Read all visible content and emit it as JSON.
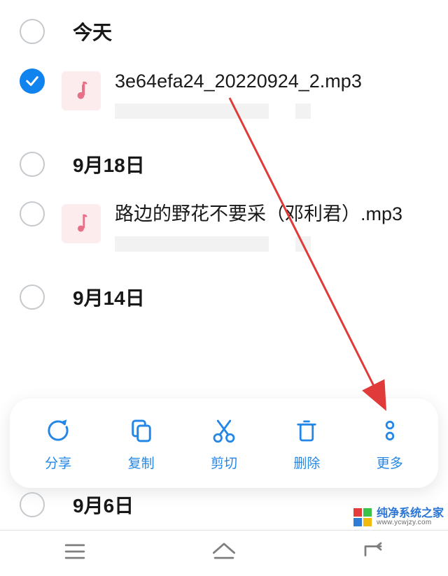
{
  "sections": {
    "today": "今天",
    "sep18": "9月18日",
    "sep14": "9月14日",
    "sep6": "9月6日"
  },
  "files": {
    "f1": {
      "name": "3e64efa24_20220924_2.mp3"
    },
    "f2": {
      "name": "路边的野花不要采（邓利君）.mp3"
    }
  },
  "toolbar": {
    "share": "分享",
    "copy": "复制",
    "cut": "剪切",
    "delete": "删除",
    "more": "更多"
  },
  "watermark": {
    "line1": "纯净系统之家",
    "line2": "www.ycwjzy.com"
  },
  "colors": {
    "accent": "#1083ee",
    "toolIcon": "#2487e8",
    "musicNote": "#e77088",
    "arrow": "#e03a3a",
    "navIcon": "#7e7e7e"
  }
}
